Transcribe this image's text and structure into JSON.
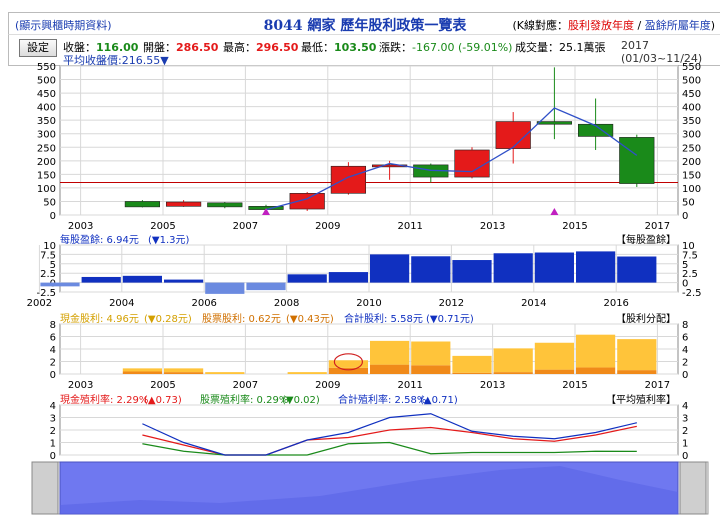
{
  "header": {
    "hint": "(顯示興櫃時期資料)",
    "title": "8044 網家 歷年股利政策一覽表",
    "k_legend_prefix": "(K線對應：",
    "k_legend_red": "股利發放年度",
    "k_legend_sep": " / ",
    "k_legend_blue": "盈餘所屬年度",
    "k_legend_suffix": ")"
  },
  "infobar": {
    "settings_label": "設定",
    "close_label": "收盤：",
    "close_value": "116.00",
    "open_label": "開盤：",
    "open_value": "286.50",
    "high_label": "最高：",
    "high_value": "296.50",
    "low_label": "最低：",
    "low_value": "103.50",
    "change_label": "漲跌：",
    "change_value": "-167.00 (-59.01%)",
    "volume_label": "成交量：",
    "volume_value": "25.1萬張",
    "period": "2017 (01/03~11/24)",
    "avg_label": "平均收盤價:216.55▼"
  },
  "colors": {
    "up": "#e41a1a",
    "down": "#1a8a1a",
    "eps": "#1030c0",
    "eps_neg": "#6b8ae0",
    "cash_div": "#ffc43a",
    "stock_div": "#f08a1a",
    "avg_line": "#c00000",
    "close_line": "#3050c8",
    "grid": "#d8d8d8",
    "nav_fill": "#6f78f0"
  },
  "chart_data": [
    {
      "type": "candlestick",
      "title": "",
      "x_ticks": [
        "2003",
        "2005",
        "2007",
        "2009",
        "2011",
        "2013",
        "2015",
        "2017"
      ],
      "ylim": [
        0,
        550
      ],
      "y_ticks": [
        0,
        50,
        100,
        150,
        200,
        250,
        300,
        350,
        400,
        450,
        500,
        550
      ],
      "avg_close": 216.55,
      "reference_line": 120,
      "candles": [
        {
          "year": 2004,
          "open": 50,
          "high": 55,
          "low": 28,
          "close": 30
        },
        {
          "year": 2005,
          "open": 32,
          "high": 55,
          "low": 30,
          "close": 48
        },
        {
          "year": 2006,
          "open": 45,
          "high": 48,
          "low": 25,
          "close": 30
        },
        {
          "year": 2007,
          "open": 32,
          "high": 38,
          "low": 18,
          "close": 20
        },
        {
          "year": 2008,
          "open": 22,
          "high": 85,
          "low": 15,
          "close": 80
        },
        {
          "year": 2009,
          "open": 80,
          "high": 195,
          "low": 75,
          "close": 180
        },
        {
          "year": 2010,
          "open": 182,
          "high": 200,
          "low": 130,
          "close": 185
        },
        {
          "year": 2011,
          "open": 185,
          "high": 190,
          "low": 120,
          "close": 140
        },
        {
          "year": 2012,
          "open": 140,
          "high": 250,
          "low": 135,
          "close": 240
        },
        {
          "year": 2013,
          "open": 245,
          "high": 380,
          "low": 190,
          "close": 345
        },
        {
          "year": 2014,
          "open": 345,
          "high": 545,
          "low": 280,
          "close": 335
        },
        {
          "year": 2015,
          "open": 335,
          "high": 430,
          "low": 240,
          "close": 290
        },
        {
          "year": 2016,
          "open": 286.5,
          "high": 296.5,
          "low": 103.5,
          "close": 116
        }
      ],
      "close_line_years": [
        2007,
        2008,
        2009,
        2010,
        2011,
        2012,
        2013,
        2014,
        2015,
        2016
      ],
      "close_line_values": [
        20,
        60,
        140,
        190,
        165,
        160,
        250,
        395,
        330,
        220
      ],
      "markers": [
        2007.0,
        2014.0
      ]
    },
    {
      "type": "bar",
      "title": "每股盈餘",
      "label": "每股盈餘: 6.94元",
      "change": "(▼1.3元)",
      "x_ticks": [
        "2002",
        "2004",
        "2006",
        "2008",
        "2010",
        "2012",
        "2014",
        "2016"
      ],
      "ylim": [
        -2.5,
        10
      ],
      "y_ticks": [
        -2.5,
        0,
        2.5,
        5,
        7.5,
        10
      ],
      "years": [
        2002,
        2003,
        2004,
        2005,
        2006,
        2007,
        2008,
        2009,
        2010,
        2011,
        2012,
        2013,
        2014,
        2015,
        2016
      ],
      "values": [
        -1.0,
        1.5,
        1.8,
        0.8,
        -3.0,
        -2.0,
        2.2,
        2.8,
        7.5,
        7.0,
        6.0,
        7.8,
        8.0,
        8.3,
        6.94
      ]
    },
    {
      "type": "stacked_bar",
      "title": "股利分配",
      "cash_label": "現金股利: 4.96元",
      "cash_change": "(▼0.28元)",
      "stock_label": "股票股利: 0.62元",
      "stock_change": "(▼0.43元)",
      "total_label": "合計股利: 5.58元",
      "total_change": "(▼0.71元)",
      "x_ticks": [
        "2003",
        "2005",
        "2007",
        "2009",
        "2011",
        "2013",
        "2015",
        "2017"
      ],
      "ylim": [
        0,
        8
      ],
      "y_ticks": [
        0,
        2,
        4,
        6,
        8
      ],
      "years": [
        2004,
        2005,
        2006,
        2007,
        2008,
        2009,
        2010,
        2011,
        2012,
        2013,
        2014,
        2015,
        2016
      ],
      "cash": [
        0.5,
        0.6,
        0.3,
        0,
        0.3,
        1.2,
        3.8,
        3.8,
        2.7,
        3.8,
        4.3,
        5.24,
        4.96
      ],
      "stock": [
        0.4,
        0.3,
        0,
        0,
        0,
        1.0,
        1.5,
        1.4,
        0.2,
        0.3,
        0.7,
        1.05,
        0.62
      ]
    },
    {
      "type": "line",
      "title": "平均殖利率",
      "cash_label": "現金殖利率: 2.29%",
      "cash_change": "(▲0.73)",
      "stock_label": "股票殖利率: 0.29%",
      "stock_change": "(▼0.02)",
      "total_label": "合計殖利率: 2.58%",
      "total_change": "(▲0.71)",
      "ylim": [
        0,
        4
      ],
      "y_ticks": [
        0,
        1,
        2,
        3,
        4
      ],
      "years": [
        2004,
        2005,
        2006,
        2007,
        2008,
        2009,
        2010,
        2011,
        2012,
        2013,
        2014,
        2015,
        2016
      ],
      "series": [
        {
          "name": "現金殖利率",
          "color": "#e41a1a",
          "values": [
            1.6,
            0.8,
            0,
            0,
            1.2,
            1.4,
            2.0,
            2.2,
            1.8,
            1.3,
            1.1,
            1.6,
            2.29
          ]
        },
        {
          "name": "股票殖利率",
          "color": "#1a8a1a",
          "values": [
            0.9,
            0.3,
            0,
            0,
            0,
            0.9,
            1.0,
            0.1,
            0.2,
            0.2,
            0.2,
            0.3,
            0.29
          ]
        },
        {
          "name": "合計殖利率",
          "color": "#1030c0",
          "values": [
            2.5,
            1.0,
            0,
            0,
            1.2,
            1.8,
            3.0,
            3.3,
            1.9,
            1.5,
            1.3,
            1.8,
            2.58
          ]
        }
      ]
    }
  ]
}
